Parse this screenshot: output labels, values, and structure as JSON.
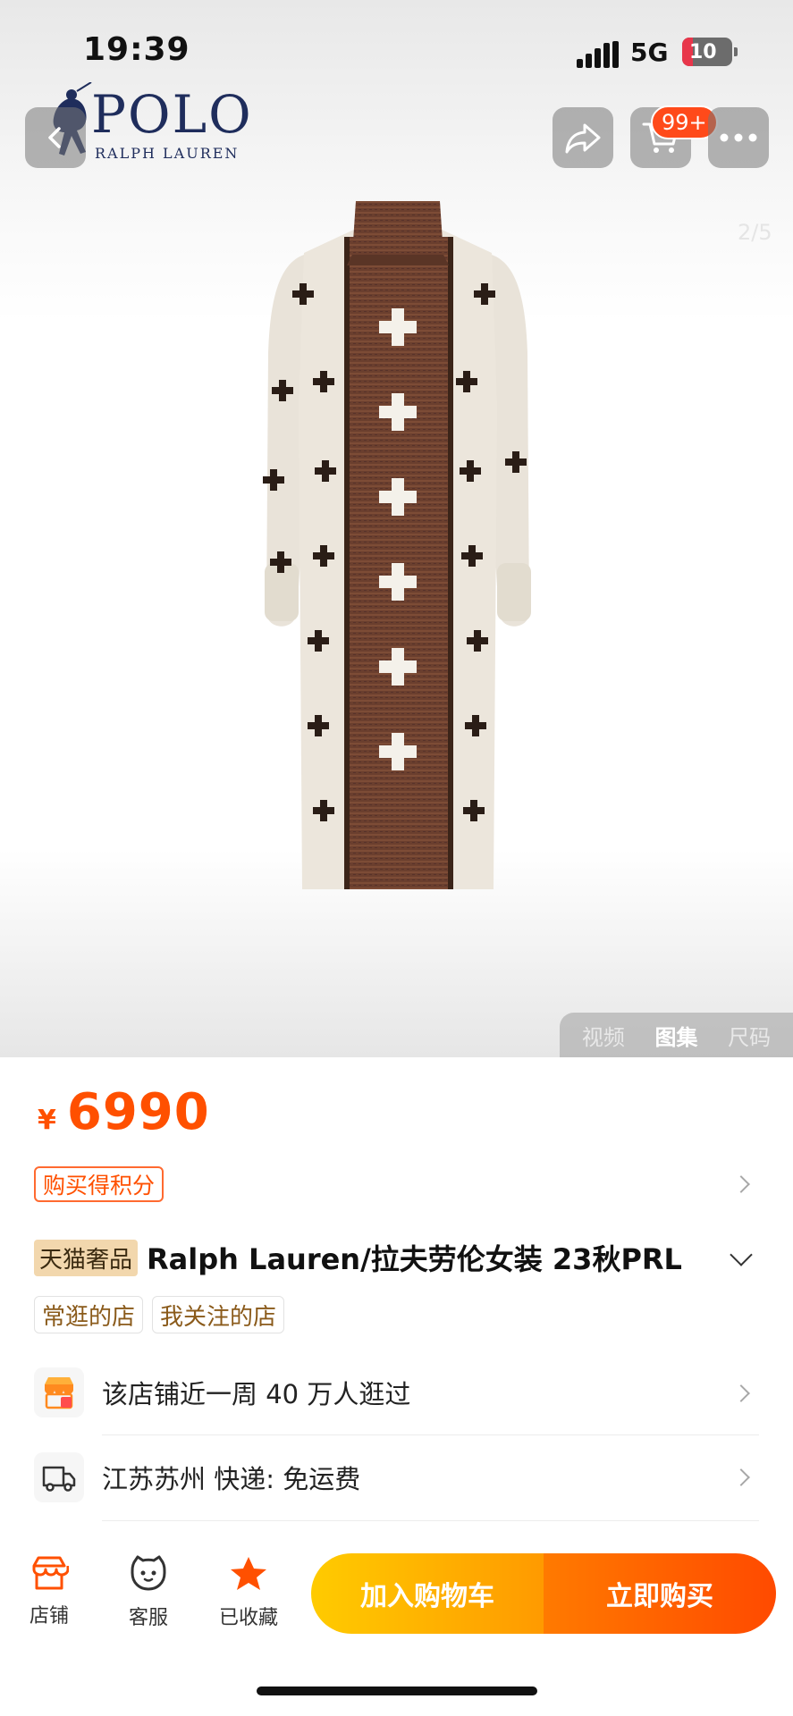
{
  "status_bar": {
    "time": "19:39",
    "network": "5G",
    "battery": "10"
  },
  "brand": {
    "name": "POLO",
    "sub": "RALPH LAUREN"
  },
  "header": {
    "cart_badge": "99+"
  },
  "gallery": {
    "page_indicator": "2/5",
    "tabs": [
      {
        "label": "视频",
        "active": false
      },
      {
        "label": "图集",
        "active": true
      },
      {
        "label": "尺码",
        "active": false
      }
    ]
  },
  "product": {
    "currency": "¥",
    "price": "6990",
    "points_tag": "购买得积分",
    "lux_tag": "天猫奢品",
    "title": "Ralph Lauren/拉夫劳伦女装 23秋PRL"
  },
  "shop_tags": [
    "常逛的店",
    "我关注的店"
  ],
  "info_rows": {
    "visitors": "该店铺近一周 40 万人逛过",
    "shipping": "江苏苏州  快递: 免运费"
  },
  "bottom_bar": {
    "store": "店铺",
    "service": "客服",
    "favorited": "已收藏",
    "add_to_cart": "加入购物车",
    "buy_now": "立即购买"
  },
  "colors": {
    "accent": "#ff5000",
    "cart_yellow": "#ffb300",
    "buy_orange": "#ff5a00",
    "fav_orange": "#ff5000"
  }
}
